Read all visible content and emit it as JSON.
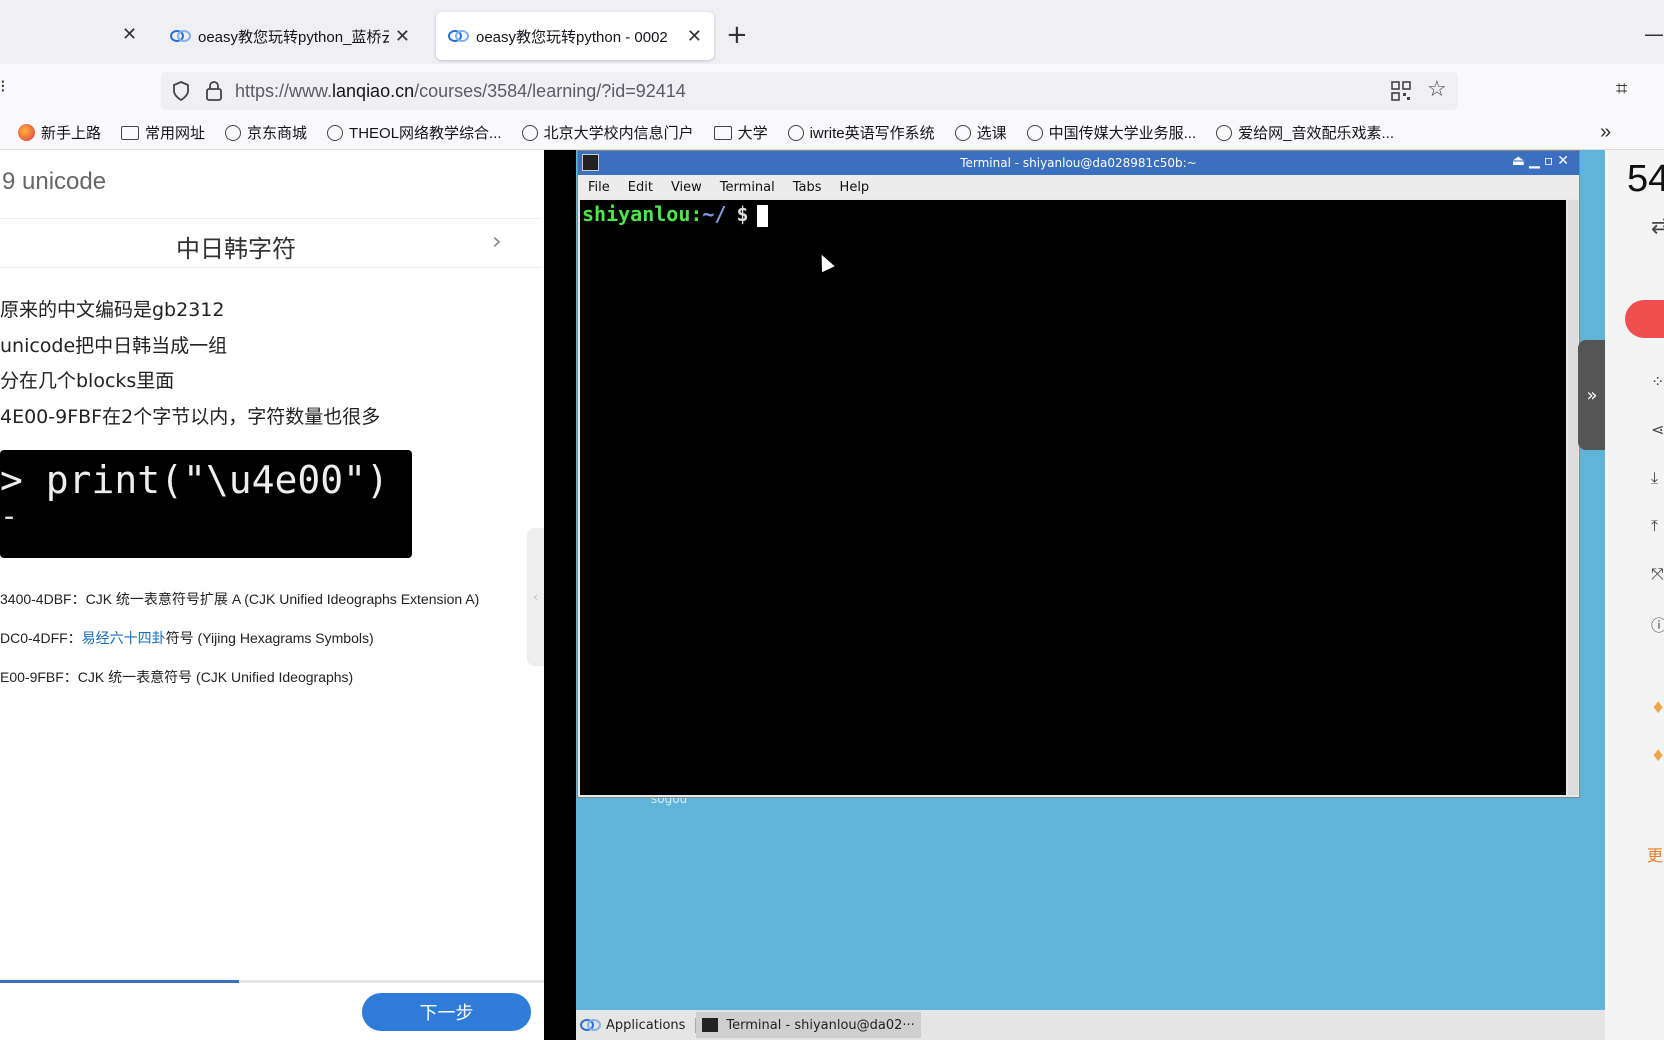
{
  "browser": {
    "tabs": [
      {
        "title": "oeasy教您玩转python_蓝桥云课",
        "active": false
      },
      {
        "title": "oeasy教您玩转python - 0002",
        "active": true
      }
    ],
    "url_prefix": "https://www.",
    "url_host": "lanqiao.cn",
    "url_path": "/courses/3584/learning/?id=92414",
    "bookmarks": [
      {
        "label": "新手上路",
        "icon": "firefox-icon"
      },
      {
        "label": "常用网址",
        "icon": "folder-icon"
      },
      {
        "label": "京东商城",
        "icon": "globe-icon"
      },
      {
        "label": "THEOL网络教学综合...",
        "icon": "globe-icon"
      },
      {
        "label": "北京大学校内信息门户",
        "icon": "globe-icon"
      },
      {
        "label": "大学",
        "icon": "folder-icon"
      },
      {
        "label": "iwrite英语写作系统",
        "icon": "globe-icon"
      },
      {
        "label": "选课",
        "icon": "globe-icon"
      },
      {
        "label": "中国传媒大学业务服...",
        "icon": "globe-icon"
      },
      {
        "label": "爱给网_音效配乐戏素...",
        "icon": "globe-icon"
      }
    ]
  },
  "lesson": {
    "title": "9 unicode",
    "section": "中日韩字符",
    "bullets": [
      "原来的中文编码是gb2312",
      "unicode把中日韩当成一组",
      "分在几个blocks里面",
      "4E00-9FBF在2个字节以内，字符数量也很多"
    ],
    "code": "> print(\"\\u4e00\")",
    "ranges": [
      {
        "prefix": "3400-4DBF：CJK 统一表意符号扩展 A (CJK Unified Ideographs Extension A)",
        "link": "",
        "suffix": ""
      },
      {
        "prefix": "DC0-4DFF：",
        "link": "易经六十四卦",
        "suffix": "符号 (Yijing Hexagrams Symbols)"
      },
      {
        "prefix": "E00-9FBF：CJK 统一表意符号 (CJK Unified Ideographs)",
        "link": "",
        "suffix": ""
      }
    ],
    "progress": 0.44,
    "next_label": "下一步"
  },
  "terminal": {
    "title": "Terminal - shiyanlou@da028981c50b:~",
    "menu": [
      "File",
      "Edit",
      "View",
      "Terminal",
      "Tabs",
      "Help"
    ],
    "prompt_user": "shiyanlou:",
    "prompt_path": "~/",
    "prompt_symbol": "$"
  },
  "desktop": {
    "sogou_label": "sogou",
    "taskbar_apps": "Applications",
    "taskbar_item": "Terminal - shiyanlou@da02···"
  },
  "rightbar": {
    "timer": "54",
    "more_label": "更"
  }
}
